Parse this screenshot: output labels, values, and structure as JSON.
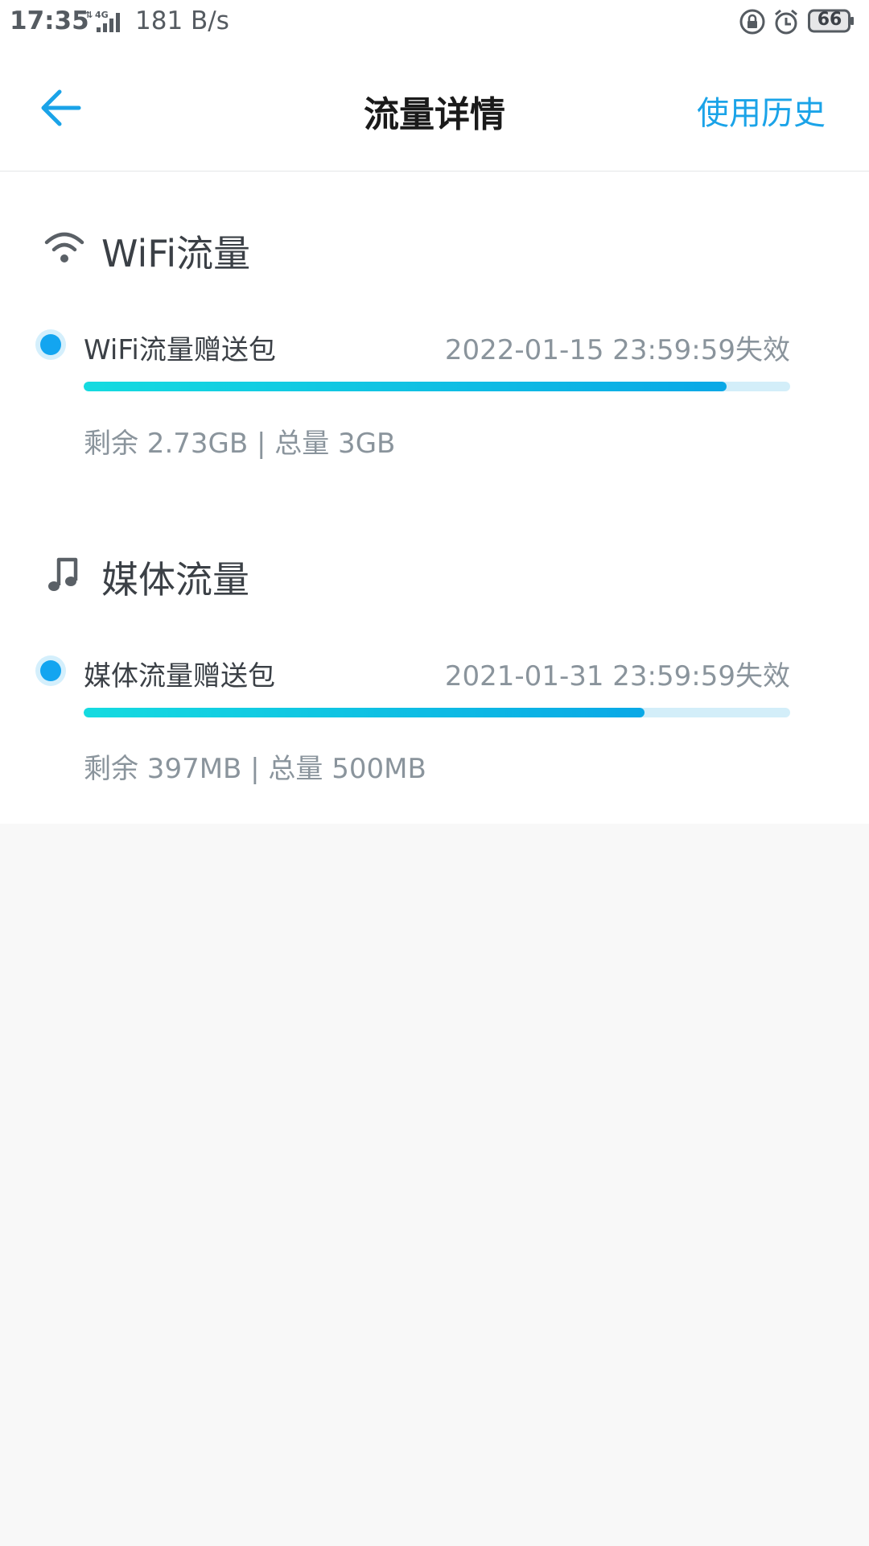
{
  "status_bar": {
    "time": "17:35",
    "network": "4G",
    "speed": "181 B/s",
    "battery": "66"
  },
  "header": {
    "title": "流量详情",
    "history_label": "使用历史"
  },
  "colors": {
    "accent": "#1aa3e8",
    "bar_start": "#15dbe0",
    "bar_end": "#0aa8e6",
    "bar_track": "#d3eef9"
  },
  "sections": [
    {
      "title": "WiFi流量",
      "icon": "wifi-icon",
      "package": {
        "name": "WiFi流量赠送包",
        "expire": "2022-01-15 23:59:59失效",
        "remain_text": "剩余 2.73GB | 总量 3GB",
        "remaining_fraction": 0.91
      }
    },
    {
      "title": "媒体流量",
      "icon": "music-note-icon",
      "package": {
        "name": "媒体流量赠送包",
        "expire": "2021-01-31 23:59:59失效",
        "remain_text": "剩余 397MB | 总量 500MB",
        "remaining_fraction": 0.794
      }
    }
  ]
}
